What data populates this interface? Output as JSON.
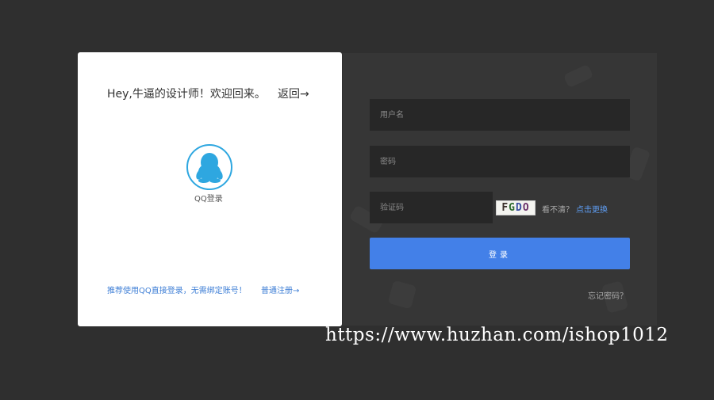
{
  "left_card": {
    "greeting": "Hey,牛逼的设计师！欢迎回来。",
    "back_label": "返回→",
    "qq_icon": "qq-penguin-icon",
    "qq_label": "QQ登录",
    "recommend_text": "推荐使用QQ直接登录，无需绑定账号！",
    "register_label": "普通注册→"
  },
  "login_form": {
    "username_placeholder": "用户名",
    "password_placeholder": "密码",
    "captcha_placeholder": "验证码",
    "captcha_chars": [
      "F",
      "G",
      "D",
      "O"
    ],
    "cant_see_text": "看不清？",
    "refresh_label": "点击更换",
    "login_button_label": "登录",
    "forgot_label": "忘记密码？"
  },
  "watermark": "https://www.huzhan.com/ishop1012",
  "colors": {
    "background": "#2f2f2f",
    "panel": "#363636",
    "input": "#272727",
    "accent_blue": "#4380e8",
    "qq_blue": "#2ea7e0",
    "link_blue": "#3f7fd6"
  }
}
